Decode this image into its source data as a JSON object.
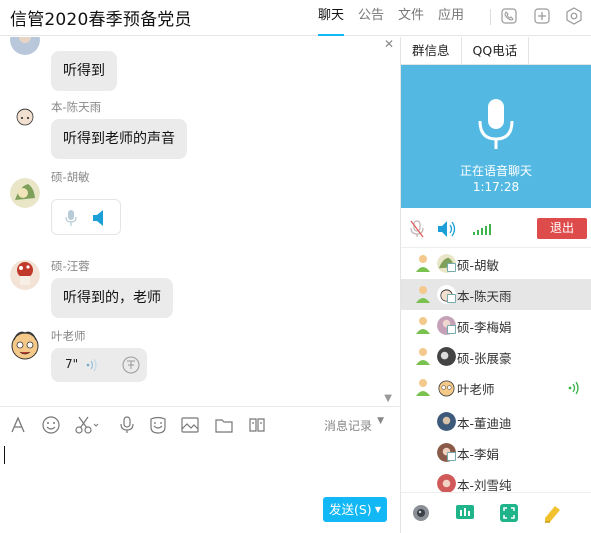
{
  "header": {
    "title": "信管2020春季预备党员",
    "tabs": [
      {
        "label": "聊天",
        "active": true
      },
      {
        "label": "公告",
        "active": false
      },
      {
        "label": "文件",
        "active": false
      },
      {
        "label": "应用",
        "active": false
      }
    ],
    "icons": [
      "phone-icon",
      "add-icon",
      "settings-icon"
    ]
  },
  "chat": {
    "messages": [
      {
        "sender": "",
        "text": "听得到",
        "avatar": "avatar-cutoff"
      },
      {
        "sender": "本-陈天雨",
        "text": "听得到老师的声音"
      },
      {
        "sender": "硕-胡敏",
        "type": "audio-status"
      },
      {
        "sender": "硕-汪蓉",
        "text": "听得到的，老师"
      },
      {
        "sender": "叶老师",
        "type": "voice",
        "duration": "7\""
      }
    ]
  },
  "toolbar": {
    "icons": [
      "font-icon",
      "emoji-icon",
      "scissors-icon",
      "mic-icon",
      "sticker-icon",
      "image-icon",
      "folder-icon",
      "more-icon"
    ],
    "history_label": "消息记录"
  },
  "input": {
    "value": ""
  },
  "send_button": {
    "label": "发送(S)"
  },
  "right_panel": {
    "tabs": [
      "群信息",
      "QQ电话"
    ],
    "voice_status": "正在语音聊天",
    "voice_time": "1:17:28",
    "exit_label": "退出",
    "members": [
      {
        "name": "硕-胡敏",
        "selected": false,
        "speaking": false
      },
      {
        "name": "本-陈天雨",
        "selected": true,
        "speaking": false
      },
      {
        "name": "硕-李梅娟",
        "selected": false,
        "speaking": false
      },
      {
        "name": "硕-张展豪",
        "selected": false,
        "speaking": false
      },
      {
        "name": "叶老师",
        "selected": false,
        "speaking": true
      },
      {
        "name": "本-董迪迪",
        "selected": false,
        "speaking": false
      },
      {
        "name": "本-李娟",
        "selected": false,
        "speaking": false
      },
      {
        "name": "本-刘雪纯",
        "selected": false,
        "speaking": false
      }
    ]
  },
  "colors": {
    "accent": "#12b7f5",
    "voice_panel": "#53b9e3",
    "exit": "#de4b4b",
    "bubble": "#ebebeb"
  }
}
